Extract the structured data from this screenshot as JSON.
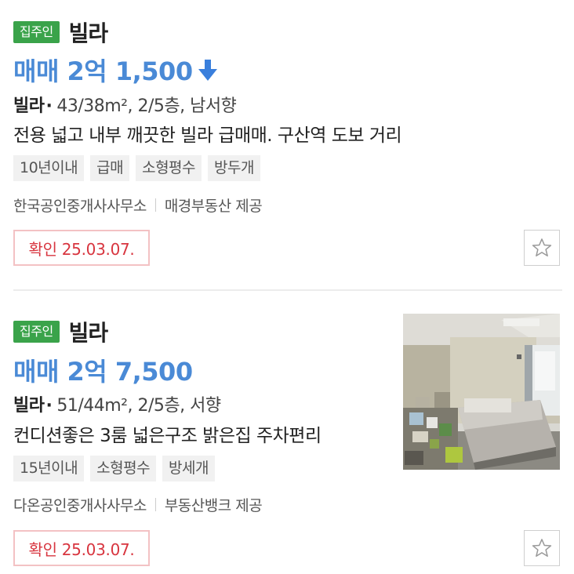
{
  "listings": [
    {
      "badge": "집주인",
      "property_type": "빌라",
      "price": "매매 2억 1,500",
      "price_change_icon": "arrow-down-icon",
      "spec_type": "빌라",
      "spec_dot": "·",
      "spec_detail": "43/38m², 2/5층, 남서향",
      "description": "전용 넓고 내부 깨끗한 빌라 급매매. 구산역 도보 거리",
      "tags": [
        "10년이내",
        "급매",
        "소형평수",
        "방두개"
      ],
      "agent": "한국공인중개사사무소",
      "provider": "매경부동산 제공",
      "confirmed": "확인 25.03.07.",
      "favorite_icon": "star-icon"
    },
    {
      "badge": "집주인",
      "property_type": "빌라",
      "price": "매매 2억 7,500",
      "spec_type": "빌라",
      "spec_dot": "·",
      "spec_detail": "51/44m², 2/5층, 서향",
      "description": "컨디션좋은 3룸 넓은구조 밝은집 주차편리",
      "tags": [
        "15년이내",
        "소형평수",
        "방세개"
      ],
      "agent": "다온공인중개사사무소",
      "provider": "부동산뱅크 제공",
      "confirmed": "확인 25.03.07.",
      "favorite_icon": "star-icon",
      "thumbnail": "bedroom-photo"
    }
  ],
  "colors": {
    "badge_green": "#3aa34a",
    "price_blue": "#4a8ad6",
    "confirm_red": "#d8353f"
  }
}
